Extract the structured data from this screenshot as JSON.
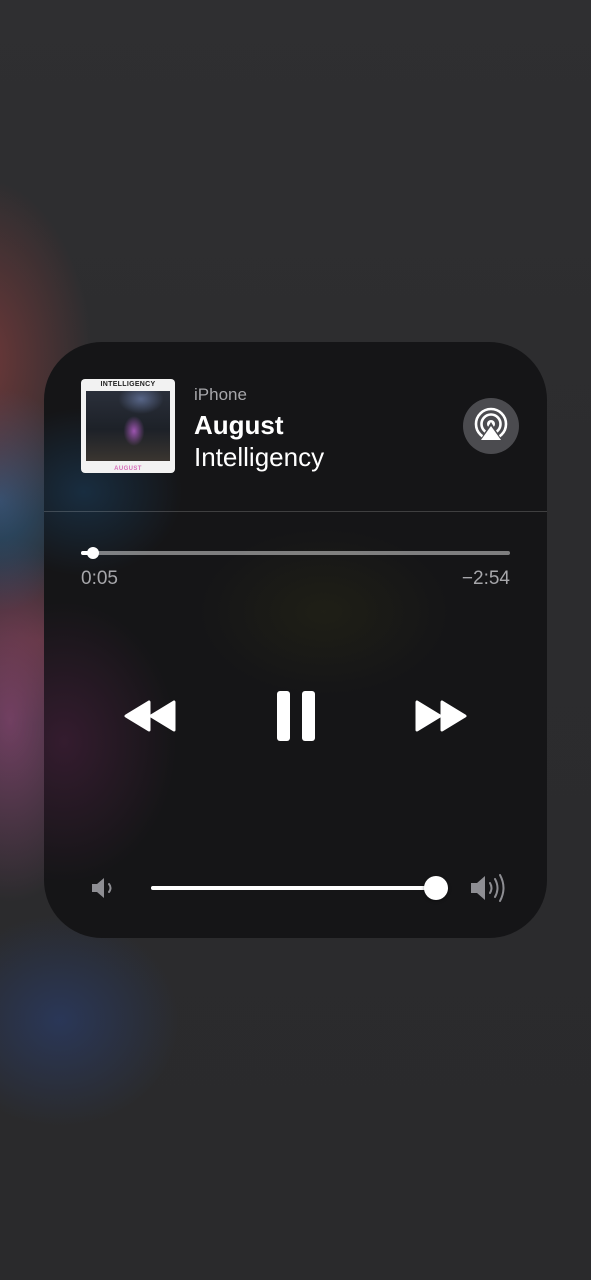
{
  "now_playing": {
    "device": "iPhone",
    "song": "August",
    "artist": "Intelligency",
    "album_art": {
      "top_text": "INTELLIGENCY",
      "bottom_text": "AUGUST"
    }
  },
  "progress": {
    "elapsed": "0:05",
    "remaining": "−2:54",
    "fraction": 0.028
  },
  "controls": {
    "rewind_icon": "rewind-icon",
    "pause_icon": "pause-icon",
    "forward_icon": "fast-forward-icon",
    "airplay_icon": "airplay-audio-icon"
  },
  "volume": {
    "low_icon": "speaker-low-icon",
    "high_icon": "speaker-high-icon",
    "fraction": 1.0
  },
  "colors": {
    "panel": "#151517",
    "secondary_text": "#a6a6aa",
    "airplay_button": "#4b4b4f"
  }
}
